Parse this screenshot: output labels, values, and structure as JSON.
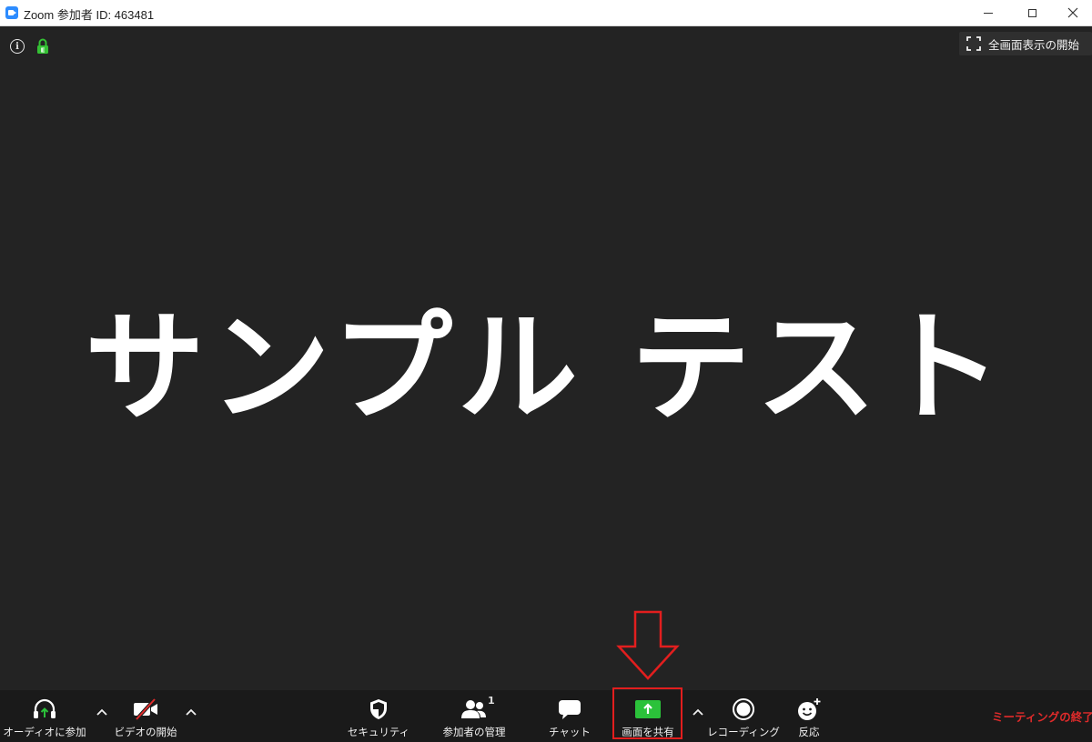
{
  "window": {
    "title": "Zoom 参加者 ID: 463481"
  },
  "meeting": {
    "shared_text": "サンプル テスト",
    "fullscreen_label": "全画面表示の開始"
  },
  "toolbar": {
    "audio_label": "オーディオに参加",
    "video_label": "ビデオの開始",
    "security_label": "セキュリティ",
    "participants_label": "参加者の管理",
    "participants_count": "1",
    "chat_label": "チャット",
    "share_label": "画面を共有",
    "record_label": "レコーディング",
    "reactions_label": "反応",
    "end_label": "ミーティングの終了"
  },
  "colors": {
    "accent_zoom": "#2D8CFF",
    "share_green": "#2BC23A",
    "annotation_red": "#E21E1E",
    "end_red": "#E02B2B",
    "lock_green": "#34C134"
  },
  "icons": [
    "app-icon",
    "minimize-icon",
    "maximize-icon",
    "close-icon",
    "info-icon",
    "lock-icon",
    "fullscreen-icon",
    "headphones-icon",
    "chevron-up-icon",
    "video-off-icon",
    "shield-icon",
    "participants-icon",
    "chat-icon",
    "share-screen-icon",
    "record-icon",
    "reaction-icon",
    "down-arrow-annotation"
  ]
}
